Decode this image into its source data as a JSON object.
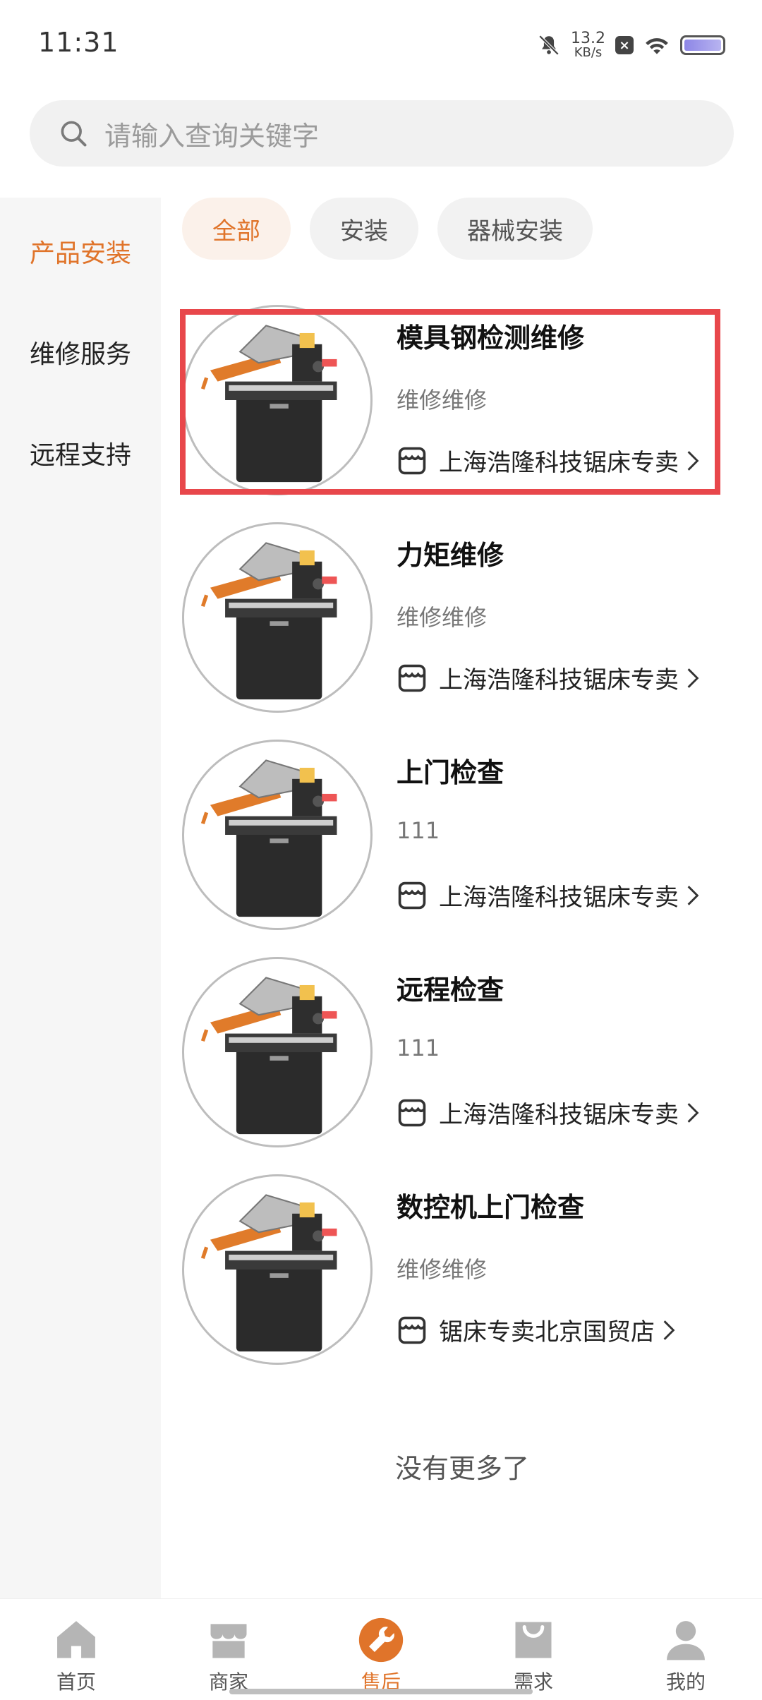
{
  "status_bar": {
    "time": "11:31",
    "net_speed_value": "13.2",
    "net_speed_unit": "KB/s"
  },
  "search": {
    "placeholder": "请输入查询关键字"
  },
  "sidebar": {
    "items": [
      {
        "label": "产品安装",
        "active": true
      },
      {
        "label": "维修服务",
        "active": false
      },
      {
        "label": "远程支持",
        "active": false
      }
    ]
  },
  "filters": [
    {
      "label": "全部",
      "active": true
    },
    {
      "label": "安装",
      "active": false
    },
    {
      "label": "器械安装",
      "active": false
    }
  ],
  "services": [
    {
      "title": "模具钢检测维修",
      "desc": "维修维修",
      "shop": "上海浩隆科技锯床专卖",
      "image_icon": "band-saw-machine"
    },
    {
      "title": "力矩维修",
      "desc": "维修维修",
      "shop": "上海浩隆科技锯床专卖",
      "image_icon": "band-saw-machine"
    },
    {
      "title": "上门检查",
      "desc": "111",
      "shop": "上海浩隆科技锯床专卖",
      "image_icon": "band-saw-machine"
    },
    {
      "title": "远程检查",
      "desc": "111",
      "shop": "上海浩隆科技锯床专卖",
      "image_icon": "band-saw-machine"
    },
    {
      "title": "数控机上门检查",
      "desc": "维修维修",
      "shop": "锯床专卖北京国贸店",
      "image_icon": "band-saw-machine"
    }
  ],
  "list_footer": "没有更多了",
  "tabbar": {
    "items": [
      {
        "label": "首页",
        "icon": "home-icon",
        "active": false
      },
      {
        "label": "商家",
        "icon": "store-icon",
        "active": false
      },
      {
        "label": "售后",
        "icon": "wrench-icon",
        "active": true
      },
      {
        "label": "需求",
        "icon": "bag-icon",
        "active": false
      },
      {
        "label": "我的",
        "icon": "user-icon",
        "active": false
      }
    ]
  },
  "colors": {
    "accent": "#e0742a",
    "highlight": "#e8474b",
    "sidebar_bg": "#f6f6f6",
    "tab_icon": "#b5b5b5"
  }
}
